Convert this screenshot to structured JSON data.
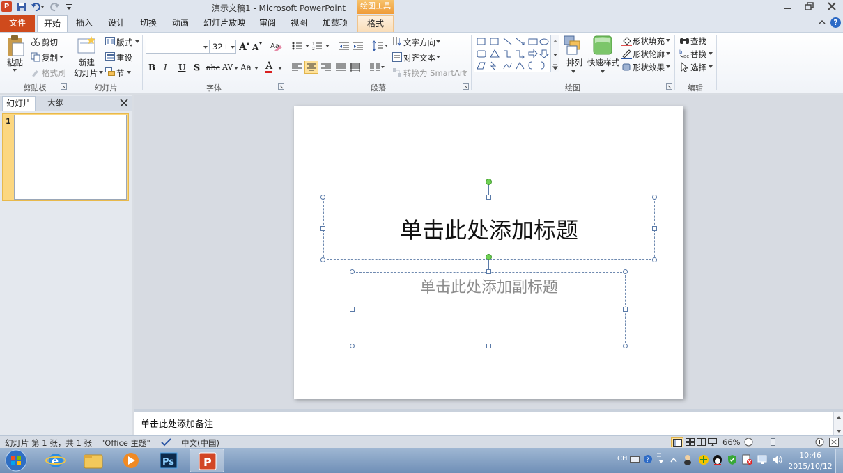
{
  "titlebar": {
    "title": "演示文稿1 - Microsoft PowerPoint",
    "context_tools": "绘图工具"
  },
  "tabs": {
    "file": "文件",
    "home": "开始",
    "insert": "插入",
    "design": "设计",
    "transitions": "切换",
    "animations": "动画",
    "slideshow": "幻灯片放映",
    "review": "审阅",
    "view": "视图",
    "addins": "加载项",
    "format": "格式"
  },
  "ribbon": {
    "clipboard": {
      "paste": "粘贴",
      "cut": "剪切",
      "copy": "复制",
      "format_painter": "格式刷",
      "label": "剪贴板"
    },
    "slides": {
      "new_slide_1": "新建",
      "new_slide_2": "幻灯片",
      "layout": "版式",
      "reset": "重设",
      "section": "节",
      "label": "幻灯片"
    },
    "font": {
      "font_name": "",
      "font_size": "32+",
      "bold": "B",
      "italic": "I",
      "underline": "U",
      "shadow": "S",
      "strike": "abc",
      "spacing": "AV",
      "case": "Aa",
      "color": "A",
      "label": "字体"
    },
    "paragraph": {
      "text_direction": "文字方向",
      "align_text": "对齐文本",
      "convert_smartart": "转换为 SmartArt",
      "label": "段落"
    },
    "drawing": {
      "arrange": "排列",
      "quick_styles": "快速样式",
      "shape_fill": "形状填充",
      "shape_outline": "形状轮廓",
      "shape_effects": "形状效果",
      "label": "绘图"
    },
    "editing": {
      "find": "查找",
      "replace": "替换",
      "select": "选择",
      "label": "编辑"
    }
  },
  "leftpane": {
    "tab_slides": "幻灯片",
    "tab_outline": "大纲",
    "slide_number": "1"
  },
  "slide": {
    "title_placeholder": "单击此处添加标题",
    "subtitle_placeholder": "单击此处添加副标题"
  },
  "notes": {
    "placeholder": "单击此处添加备注"
  },
  "status": {
    "slide_info": "幻灯片 第 1 张，共 1 张",
    "theme": "\"Office 主题\"",
    "language": "中文(中国)",
    "zoom": "66%"
  },
  "taskbar": {
    "ime": "CH",
    "time": "10:46",
    "date": "2015/10/12"
  },
  "colors": {
    "file_tab": "#cf4a1c",
    "context_tab": "#f0a040",
    "selection": "#ffe29a",
    "rotate_handle": "#6fd054"
  }
}
